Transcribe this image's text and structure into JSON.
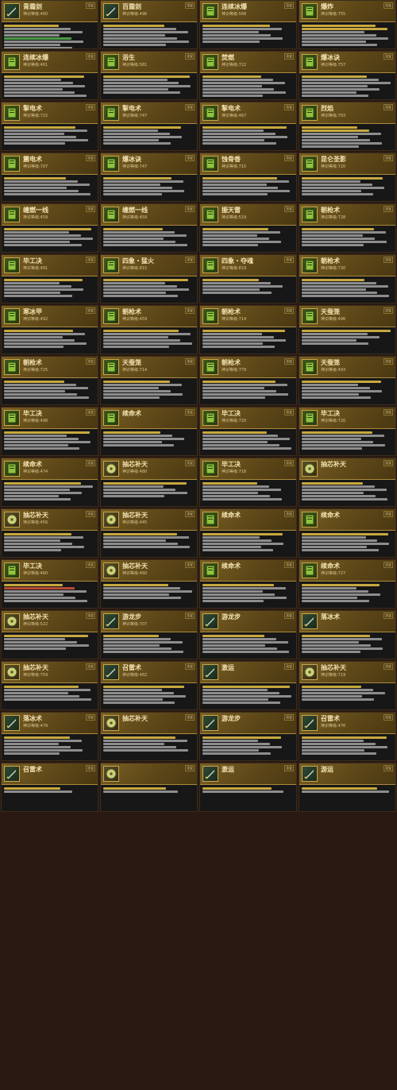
{
  "page": {
    "title": ""
  },
  "ui": {
    "level_prefix": "神识等级:",
    "tag_label": "法宝"
  },
  "cards": [
    {
      "name": "青霜剑",
      "level": "460",
      "icon": "sword",
      "lines": [
        "y",
        "w",
        "w",
        "w",
        "g",
        "w",
        "w",
        "w"
      ],
      "note": ""
    },
    {
      "name": "百霜剑",
      "level": "496",
      "icon": "sword",
      "lines": [
        "y",
        "w",
        "w",
        "w",
        "w",
        "w",
        "w"
      ],
      "note": ""
    },
    {
      "name": "连续冰爆",
      "level": "568",
      "icon": "book",
      "lines": [
        "y",
        "w",
        "w",
        "w",
        "w",
        "w"
      ],
      "note": ""
    },
    {
      "name": "爆炸",
      "level": "755",
      "icon": "book",
      "lines": [
        "y",
        "y",
        "w",
        "w",
        "w",
        "w",
        "w"
      ],
      "note": ""
    },
    {
      "name": "连续冰爆",
      "level": "461",
      "icon": "book",
      "lines": [
        "y",
        "w",
        "w",
        "w",
        "w",
        "w",
        "w"
      ],
      "note": ""
    },
    {
      "name": "浴生",
      "level": "581",
      "icon": "book",
      "lines": [
        "y",
        "w",
        "w",
        "w",
        "w",
        "w"
      ],
      "note": ""
    },
    {
      "name": "焚燃",
      "level": "722",
      "icon": "book",
      "lines": [
        "y",
        "w",
        "w",
        "w",
        "w",
        "w",
        "w"
      ],
      "note": ""
    },
    {
      "name": "爆冰诀",
      "level": "757",
      "icon": "book",
      "lines": [
        "y",
        "w",
        "w",
        "w",
        "w",
        "w",
        "w"
      ],
      "note": ""
    },
    {
      "name": "掣电术",
      "level": "722",
      "icon": "book",
      "lines": [
        "y",
        "w",
        "w",
        "w",
        "w",
        "w"
      ],
      "note": ""
    },
    {
      "name": "掣电术",
      "level": "747",
      "icon": "book",
      "lines": [
        "y",
        "w",
        "w",
        "w",
        "w",
        "w"
      ],
      "note": ""
    },
    {
      "name": "掣电术",
      "level": "467",
      "icon": "book",
      "lines": [
        "y",
        "w",
        "w",
        "w",
        "w",
        "w"
      ],
      "note": ""
    },
    {
      "name": "烈焰",
      "level": "793",
      "icon": "book",
      "lines": [
        "y",
        "y",
        "w",
        "w",
        "w",
        "w",
        "w"
      ],
      "note": ""
    },
    {
      "name": "震电术",
      "level": "707",
      "icon": "book",
      "lines": [
        "y",
        "w",
        "w",
        "w",
        "w",
        "w"
      ],
      "note": ""
    },
    {
      "name": "爆冰诀",
      "level": "747",
      "icon": "book",
      "lines": [
        "y",
        "w",
        "w",
        "w",
        "w",
        "w"
      ],
      "note": ""
    },
    {
      "name": "蚀骨香",
      "level": "715",
      "icon": "book",
      "lines": [
        "y",
        "w",
        "w",
        "w",
        "w",
        "w"
      ],
      "note": ""
    },
    {
      "name": "昆仑圣影",
      "level": "720",
      "icon": "book",
      "lines": [
        "y",
        "w",
        "w",
        "w",
        "w",
        "w"
      ],
      "note": ""
    },
    {
      "name": "缠燃一线",
      "level": "459",
      "icon": "book",
      "lines": [
        "y",
        "w",
        "w",
        "w",
        "w",
        "w"
      ],
      "note": ""
    },
    {
      "name": "缠燃一线",
      "level": "459",
      "icon": "book",
      "lines": [
        "y",
        "w",
        "w",
        "w",
        "w",
        "w"
      ],
      "note": ""
    },
    {
      "name": "振天雷",
      "level": "519",
      "icon": "book",
      "lines": [
        "y",
        "w",
        "w",
        "w",
        "w",
        "w"
      ],
      "note": ""
    },
    {
      "name": "朝枪术",
      "level": "728",
      "icon": "book",
      "lines": [
        "y",
        "w",
        "w",
        "w",
        "w",
        "w"
      ],
      "note": ""
    },
    {
      "name": "毕工决",
      "level": "491",
      "icon": "book",
      "lines": [
        "y",
        "w",
        "w",
        "w",
        "w",
        "w"
      ],
      "note": ""
    },
    {
      "name": "四象・猛火",
      "level": "815",
      "icon": "book",
      "lines": [
        "y",
        "w",
        "w",
        "w",
        "w",
        "w"
      ],
      "note": ""
    },
    {
      "name": "四象・夺魂",
      "level": "819",
      "icon": "book",
      "lines": [
        "y",
        "w",
        "w",
        "w",
        "w"
      ],
      "note": ""
    },
    {
      "name": "朝枪术",
      "level": "730",
      "icon": "book",
      "lines": [
        "y",
        "w",
        "w",
        "w",
        "w",
        "w"
      ],
      "note": ""
    },
    {
      "name": "寒冰甲",
      "level": "492",
      "icon": "book",
      "lines": [
        "y",
        "w",
        "w",
        "w",
        "w",
        "w"
      ],
      "note": ""
    },
    {
      "name": "朝枪术",
      "level": "459",
      "icon": "book",
      "lines": [
        "y",
        "w",
        "w",
        "w",
        "w",
        "w"
      ],
      "note": ""
    },
    {
      "name": "朝枪术",
      "level": "714",
      "icon": "book",
      "lines": [
        "y",
        "w",
        "w",
        "w",
        "w",
        "w"
      ],
      "note": ""
    },
    {
      "name": "天蚕笼",
      "level": "496",
      "icon": "book",
      "lines": [
        "y",
        "w",
        "w",
        "w",
        "w"
      ],
      "note": ""
    },
    {
      "name": "朝枪术",
      "level": "725",
      "icon": "book",
      "lines": [
        "y",
        "w",
        "w",
        "w",
        "w",
        "w"
      ],
      "note": ""
    },
    {
      "name": "天蚕笼",
      "level": "714",
      "icon": "book",
      "lines": [
        "y",
        "w",
        "w",
        "w",
        "w",
        "w"
      ],
      "note": ""
    },
    {
      "name": "朝枪术",
      "level": "779",
      "icon": "book",
      "lines": [
        "y",
        "w",
        "w",
        "w",
        "w",
        "w"
      ],
      "note": ""
    },
    {
      "name": "天蚕笼",
      "level": "493",
      "icon": "book",
      "lines": [
        "y",
        "w",
        "w",
        "w",
        "w",
        "w"
      ],
      "note": ""
    },
    {
      "name": "毕工决",
      "level": "498",
      "icon": "book",
      "lines": [
        "y",
        "w",
        "w",
        "w",
        "w",
        "w"
      ],
      "note": ""
    },
    {
      "name": "续命术",
      "level": "",
      "icon": "book",
      "lines": [
        "y",
        "w",
        "w",
        "w",
        "w"
      ],
      "note": ""
    },
    {
      "name": "毕工决",
      "level": "720",
      "icon": "book",
      "lines": [
        "y",
        "w",
        "w",
        "w",
        "w",
        "w"
      ],
      "note": ""
    },
    {
      "name": "毕工决",
      "level": "720",
      "icon": "book",
      "lines": [
        "y",
        "w",
        "w",
        "w",
        "w",
        "w"
      ],
      "note": ""
    },
    {
      "name": "续命术",
      "level": "474",
      "icon": "book",
      "lines": [
        "y",
        "w",
        "w",
        "w",
        "w",
        "w"
      ],
      "note": ""
    },
    {
      "name": "抽芯补天",
      "level": "480",
      "icon": "coin",
      "lines": [
        "y",
        "w",
        "w",
        "w",
        "w"
      ],
      "note": ""
    },
    {
      "name": "毕工决",
      "level": "718",
      "icon": "book",
      "lines": [
        "y",
        "w",
        "w",
        "w",
        "w",
        "w"
      ],
      "note": ""
    },
    {
      "name": "抽芯补天",
      "level": "",
      "icon": "coin",
      "lines": [
        "y",
        "w",
        "w",
        "w",
        "w",
        "w"
      ],
      "note": ""
    },
    {
      "name": "抽芯补天",
      "level": "456",
      "icon": "coin",
      "lines": [
        "y",
        "w",
        "w",
        "w",
        "w",
        "w"
      ],
      "note": ""
    },
    {
      "name": "抽芯补天",
      "level": "445",
      "icon": "coin",
      "lines": [
        "y",
        "w",
        "w",
        "w",
        "w"
      ],
      "note": ""
    },
    {
      "name": "续命术",
      "level": "",
      "icon": "book",
      "lines": [
        "y",
        "w",
        "w",
        "w",
        "w",
        "w"
      ],
      "note": ""
    },
    {
      "name": "续命术",
      "level": "",
      "icon": "book",
      "lines": [
        "y",
        "w",
        "w",
        "w",
        "w",
        "w"
      ],
      "note": ""
    },
    {
      "name": "毕工决",
      "level": "460",
      "icon": "book",
      "lines": [
        "y",
        "r",
        "w",
        "w",
        "w",
        "w"
      ],
      "note": ""
    },
    {
      "name": "抽芯补天",
      "level": "460",
      "icon": "coin",
      "lines": [
        "y",
        "w",
        "w",
        "w",
        "w"
      ],
      "note": ""
    },
    {
      "name": "续命术",
      "level": "",
      "icon": "book",
      "lines": [
        "y",
        "w",
        "w",
        "w",
        "w",
        "w"
      ],
      "note": ""
    },
    {
      "name": "续命术",
      "level": "727",
      "icon": "book",
      "lines": [
        "y",
        "w",
        "w",
        "w",
        "w",
        "w"
      ],
      "note": ""
    },
    {
      "name": "抽芯补天",
      "level": "522",
      "icon": "coin",
      "lines": [
        "y",
        "w",
        "w",
        "w",
        "w"
      ],
      "note": ""
    },
    {
      "name": "游龙步",
      "level": "707",
      "icon": "sword",
      "lines": [
        "y",
        "w",
        "w",
        "w",
        "w",
        "w"
      ],
      "note": ""
    },
    {
      "name": "游龙步",
      "level": "",
      "icon": "sword",
      "lines": [
        "y",
        "w",
        "w",
        "w",
        "w",
        "w"
      ],
      "note": ""
    },
    {
      "name": "落冰术",
      "level": "",
      "icon": "sword",
      "lines": [
        "y",
        "w",
        "w",
        "w",
        "w",
        "w"
      ],
      "note": ""
    },
    {
      "name": "抽芯补天",
      "level": "759",
      "icon": "coin",
      "lines": [
        "y",
        "w",
        "w",
        "w",
        "w"
      ],
      "note": ""
    },
    {
      "name": "召雷术",
      "level": "482",
      "icon": "sword",
      "lines": [
        "y",
        "w",
        "w",
        "w",
        "w",
        "w"
      ],
      "note": ""
    },
    {
      "name": "激运",
      "level": "",
      "icon": "sword",
      "lines": [
        "y",
        "w",
        "w",
        "w",
        "w",
        "w"
      ],
      "note": ""
    },
    {
      "name": "抽芯补天",
      "level": "719",
      "icon": "coin",
      "lines": [
        "y",
        "w",
        "w",
        "w",
        "w"
      ],
      "note": ""
    },
    {
      "name": "落冰术",
      "level": "479",
      "icon": "sword",
      "lines": [
        "y",
        "w",
        "w",
        "w",
        "w",
        "w"
      ],
      "note": ""
    },
    {
      "name": "抽芯补天",
      "level": "",
      "icon": "coin",
      "lines": [
        "y",
        "w",
        "w",
        "w",
        "w"
      ],
      "note": ""
    },
    {
      "name": "游龙步",
      "level": "",
      "icon": "sword",
      "lines": [
        "y",
        "w",
        "w",
        "w",
        "w",
        "w"
      ],
      "note": ""
    },
    {
      "name": "召雷术",
      "level": "476",
      "icon": "sword",
      "lines": [
        "y",
        "w",
        "w",
        "w",
        "w",
        "w"
      ],
      "note": ""
    },
    {
      "name": "召雷术",
      "level": "",
      "icon": "sword",
      "lines": [
        "y",
        "w"
      ],
      "note": ""
    },
    {
      "name": "",
      "level": "",
      "icon": "coin",
      "lines": [
        "y",
        "w"
      ],
      "note": ""
    },
    {
      "name": "激运",
      "level": "",
      "icon": "sword",
      "lines": [
        "y",
        "w"
      ],
      "note": ""
    },
    {
      "name": "游运",
      "level": "",
      "icon": "sword",
      "lines": [
        "y",
        "w"
      ],
      "note": ""
    }
  ]
}
